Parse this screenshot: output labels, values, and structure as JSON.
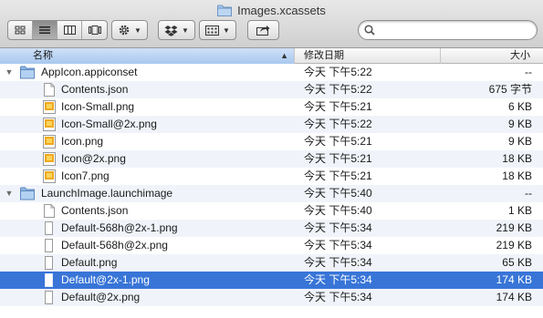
{
  "window": {
    "title": "Images.xcassets"
  },
  "toolbar": {
    "view_modes": [
      "icon-view",
      "list-view",
      "column-view",
      "coverflow-view"
    ],
    "active_view": 1,
    "action_icon": "gear-icon",
    "dropbox_icon": "dropbox-icon",
    "arrange_icon": "arrange-icon",
    "share_icon": "share-icon"
  },
  "search": {
    "placeholder": "",
    "value": ""
  },
  "columns": {
    "name": "名称",
    "date": "修改日期",
    "size": "大小"
  },
  "files": [
    {
      "level": 0,
      "type": "folder",
      "expanded": true,
      "name": "AppIcon.appiconset",
      "date": "今天 下午5:22",
      "size": "--"
    },
    {
      "level": 1,
      "type": "doc",
      "name": "Contents.json",
      "date": "今天 下午5:22",
      "size": "675 字节"
    },
    {
      "level": 1,
      "type": "image",
      "name": "Icon-Small.png",
      "date": "今天 下午5:21",
      "size": "6 KB"
    },
    {
      "level": 1,
      "type": "image",
      "name": "Icon-Small@2x.png",
      "date": "今天 下午5:22",
      "size": "9 KB"
    },
    {
      "level": 1,
      "type": "image",
      "name": "Icon.png",
      "date": "今天 下午5:21",
      "size": "9 KB"
    },
    {
      "level": 1,
      "type": "image",
      "name": "Icon@2x.png",
      "date": "今天 下午5:21",
      "size": "18 KB"
    },
    {
      "level": 1,
      "type": "image",
      "name": "Icon7.png",
      "date": "今天 下午5:21",
      "size": "18 KB"
    },
    {
      "level": 0,
      "type": "folder",
      "expanded": true,
      "name": "LaunchImage.launchimage",
      "date": "今天 下午5:40",
      "size": "--"
    },
    {
      "level": 1,
      "type": "doc",
      "name": "Contents.json",
      "date": "今天 下午5:40",
      "size": "1 KB"
    },
    {
      "level": 1,
      "type": "blank",
      "name": "Default-568h@2x-1.png",
      "date": "今天 下午5:34",
      "size": "219 KB"
    },
    {
      "level": 1,
      "type": "blank",
      "name": "Default-568h@2x.png",
      "date": "今天 下午5:34",
      "size": "219 KB"
    },
    {
      "level": 1,
      "type": "blank",
      "name": "Default.png",
      "date": "今天 下午5:34",
      "size": "65 KB"
    },
    {
      "level": 1,
      "type": "blank",
      "name": "Default@2x-1.png",
      "date": "今天 下午5:34",
      "size": "174 KB",
      "selected": true
    },
    {
      "level": 1,
      "type": "blank",
      "name": "Default@2x.png",
      "date": "今天 下午5:34",
      "size": "174 KB"
    }
  ],
  "colors": {
    "selection": "#3875d7",
    "alt_row": "#f0f4fa",
    "header_active": "#a8c8ef"
  }
}
